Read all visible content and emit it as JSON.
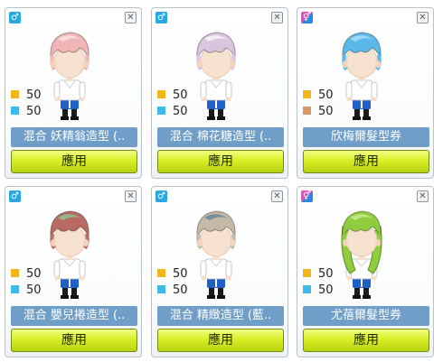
{
  "colors": {
    "gold": "#f2b51d",
    "blue": "#3db9ea",
    "tan": "#d7986a",
    "name_bar": "#6f9ec8",
    "apply_button": "#d8ef26"
  },
  "close_label": "✕",
  "cards": [
    {
      "gender": "male",
      "gender_symbol": "♂",
      "stat1": "50",
      "stat1_color": "gold",
      "stat2": "50",
      "stat2_color": "blue",
      "name": "混合 妖精翁造型 (..",
      "apply_label": "應用",
      "hair_color": "#f0b5b7",
      "hair_highlight": "#fbe0dd"
    },
    {
      "gender": "male",
      "gender_symbol": "♂",
      "stat1": "50",
      "stat1_color": "gold",
      "stat2": "50",
      "stat2_color": "blue",
      "name": "混合 棉花糖造型 (..",
      "apply_label": "應用",
      "hair_color": "#d9c5dd",
      "hair_highlight": "#f6f0f8"
    },
    {
      "gender": "unisex",
      "gender_symbol": "⚥",
      "stat1": "50",
      "stat1_color": "gold",
      "stat2": "50",
      "stat2_color": "tan",
      "name": "欣梅爾髮型券",
      "apply_label": "應用",
      "hair_color": "#5bb8ea",
      "hair_highlight": "#a9dcf7"
    },
    {
      "gender": "male",
      "gender_symbol": "♂",
      "stat1": "50",
      "stat1_color": "gold",
      "stat2": "50",
      "stat2_color": "blue",
      "name": "混合 嬰兒捲造型 (..",
      "apply_label": "應用",
      "hair_color": "#b96a63",
      "hair_highlight": "#8fc08d"
    },
    {
      "gender": "male",
      "gender_symbol": "♂",
      "stat1": "50",
      "stat1_color": "gold",
      "stat2": "50",
      "stat2_color": "blue",
      "name": "混合 精緻造型 (藍..",
      "apply_label": "應用",
      "hair_color": "#c4b8a6",
      "hair_highlight": "#6f8a9c"
    },
    {
      "gender": "unisex",
      "gender_symbol": "⚥",
      "stat1": "50",
      "stat1_color": "gold",
      "stat2": "50",
      "stat2_color": "blue",
      "name": "尤蓓爾髮型券",
      "apply_label": "應用",
      "hair_color": "#8fcd3f",
      "hair_highlight": "#c3e98a"
    }
  ]
}
